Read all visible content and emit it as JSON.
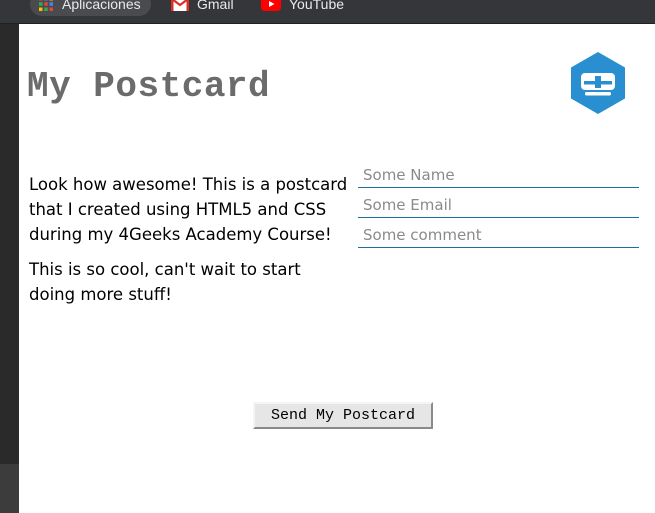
{
  "browser": {
    "bookmarks": [
      {
        "label": "Aplicaciones",
        "icon": "apps-grid-icon"
      },
      {
        "label": "Gmail",
        "icon": "gmail-icon"
      },
      {
        "label": "YouTube",
        "icon": "youtube-icon"
      }
    ]
  },
  "postcard": {
    "title": "My Postcard",
    "logo_icon": "4geeks-logo-icon",
    "logo_color": "#2a8fd0",
    "message": [
      "Look how awesome! This is a postcard that I created using HTML5 and CSS during my 4Geeks Academy Course!",
      "This is so cool, can't wait to start doing more stuff!"
    ],
    "form": {
      "name_placeholder": "Some Name",
      "email_placeholder": "Some Email",
      "comment_placeholder": "Some comment",
      "submit_label": "Send My Postcard"
    }
  },
  "colors": {
    "title": "#6b6b6b",
    "input_underline": "#1e6fa0",
    "bookmark_bar": "#35363a"
  }
}
